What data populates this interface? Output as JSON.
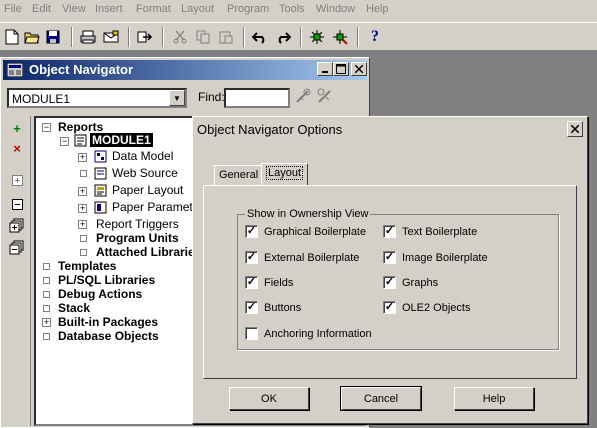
{
  "menubar": {
    "items": [
      "File",
      "Edit",
      "View",
      "Insert",
      "Format",
      "Layout",
      "Program",
      "Tools",
      "Window",
      "Help"
    ]
  },
  "toolbar": {
    "buttons": [
      "new-icon",
      "open-icon",
      "save-icon",
      "print-icon",
      "mail-icon",
      "compile-icon",
      "cut-icon",
      "copy-icon",
      "paste-icon",
      "undo-icon",
      "redo-icon",
      "run-icon",
      "debug-icon",
      "help-icon"
    ]
  },
  "navigator": {
    "title": "Object Navigator",
    "module_value": "MODULE1",
    "find_label": "Find:",
    "find_value": "",
    "side_buttons": [
      "add-icon",
      "delete-icon",
      "expand-icon",
      "collapse-icon",
      "expand-all-icon",
      "collapse-all-icon"
    ],
    "tree": {
      "reports": "Reports",
      "module1": "MODULE1",
      "data_model": "Data Model",
      "web_source": "Web Source",
      "paper_layout": "Paper Layout",
      "paper_parameter": "Paper Parameter",
      "report_triggers": "Report Triggers",
      "program_units": "Program Units",
      "attached_libraries": "Attached Librarie",
      "templates": "Templates",
      "plsql_libraries": "PL/SQL Libraries",
      "debug_actions": "Debug Actions",
      "stack": "Stack",
      "builtin_packages": "Built-in Packages",
      "database_objects": "Database Objects"
    }
  },
  "dialog": {
    "title": "Object Navigator Options",
    "tabs": [
      "General",
      "Layout"
    ],
    "active_tab": "Layout",
    "group_label": "Show in Ownership View",
    "options": {
      "graphical_boilerplate": {
        "label": "Graphical Boilerplate",
        "checked": true
      },
      "text_boilerplate": {
        "label": "Text Boilerplate",
        "checked": true
      },
      "external_boilerplate": {
        "label": "External Boilerplate",
        "checked": true
      },
      "image_boilerplate": {
        "label": "Image Boilerplate",
        "checked": true
      },
      "fields": {
        "label": "Fields",
        "checked": true
      },
      "graphs": {
        "label": "Graphs",
        "checked": true
      },
      "buttons": {
        "label": "Buttons",
        "checked": true
      },
      "ole2_objects": {
        "label": "OLE2 Objects",
        "checked": true
      },
      "anchoring_information": {
        "label": "Anchoring Information",
        "checked": false
      }
    },
    "ok_label": "OK",
    "cancel_label": "Cancel",
    "help_label": "Help"
  },
  "colors": {
    "title_active_start": "#0a246a",
    "title_active_end": "#a6caf0",
    "face": "#d4d0c8",
    "workspace": "#808080"
  }
}
